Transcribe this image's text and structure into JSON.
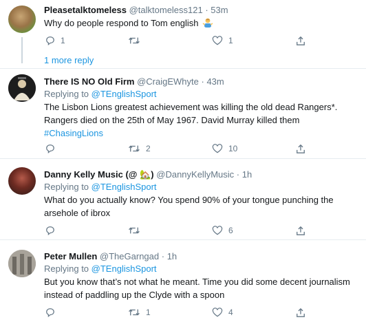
{
  "colors": {
    "link": "#1b95e0",
    "muted": "#657786",
    "divider": "#e6ecf0"
  },
  "tweets": [
    {
      "name": "Pleasetalktomeless",
      "handle": "@talktomeless121",
      "time": "· 53m",
      "replying_label": "",
      "replying_to": "",
      "text": "Why do people respond to Tom english",
      "emoji": "man-shrugging-emoji",
      "hashtag": "",
      "replies": "1",
      "retweets": "",
      "likes": "1",
      "more_replies": "1 more reply"
    },
    {
      "name": "There IS NO Old Firm",
      "handle": "@CraigEWhyte",
      "time": "· 43m",
      "replying_label": "Replying to",
      "replying_to": "@TEnglishSport",
      "text": "The Lisbon Lions greatest achievement was killing the old dead Rangers*. Rangers died on the 25th of May 1967. David Murray killed them",
      "hashtag": "#ChasingLions",
      "replies": "",
      "retweets": "2",
      "likes": "10"
    },
    {
      "name": "Danny Kelly Music (@ 🏡)",
      "handle": "@DannyKellyMusic",
      "time": "· 1h",
      "replying_label": "Replying to",
      "replying_to": "@TEnglishSport",
      "text": "What do you actually know? You spend 90% of your tongue punching the arsehole of ibrox",
      "hashtag": "",
      "replies": "",
      "retweets": "",
      "likes": "6"
    },
    {
      "name": "Peter Mullen",
      "handle": "@TheGarngad",
      "time": "· 1h",
      "replying_label": "Replying to",
      "replying_to": "@TEnglishSport",
      "text": "But you know that’s not what he meant. Time you did some decent journalism instead of paddling up the Clyde with a spoon",
      "hashtag": "",
      "replies": "",
      "retweets": "1",
      "likes": "4"
    }
  ]
}
